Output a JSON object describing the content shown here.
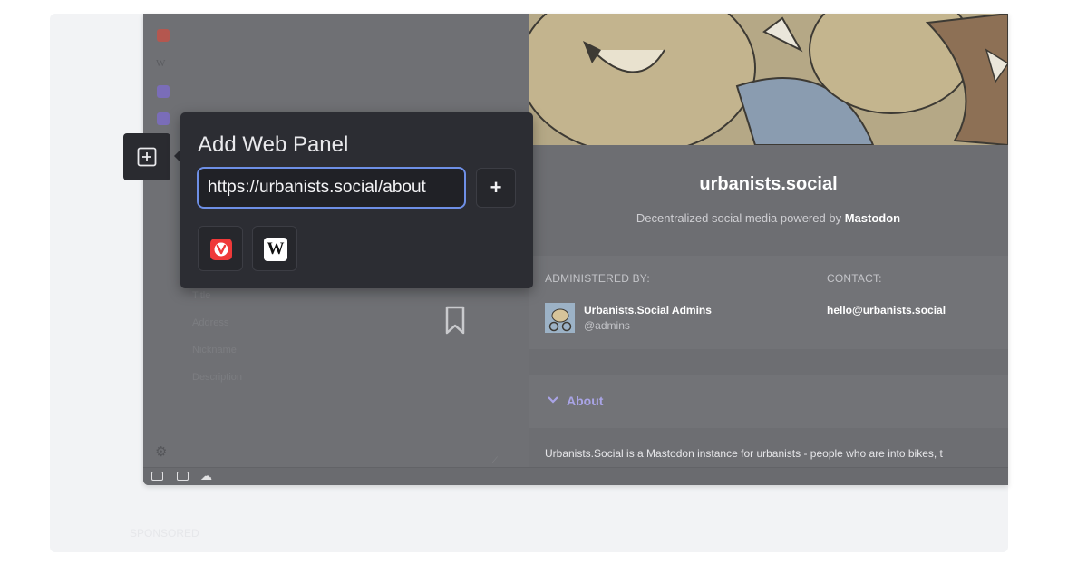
{
  "background": {
    "watermark": "SPONSORED"
  },
  "panel_form": {
    "labels": [
      "Title",
      "Address",
      "Nickname",
      "Description"
    ]
  },
  "popup": {
    "title": "Add Web Panel",
    "url_value": "https://urbanists.social/about",
    "add_button_label": "+",
    "preset_wikipedia_label": "W"
  },
  "website": {
    "title": "urbanists.social",
    "subtitle_prefix": "Decentralized social media powered by",
    "subtitle_brand": "Mastodon",
    "administered_by_heading": "ADMINISTERED BY:",
    "admin_name": "Urbanists.Social Admins",
    "admin_handle": "@admins",
    "contact_heading": "CONTACT:",
    "contact_email": "hello@urbanists.social",
    "about_label": "About",
    "about_text": "Urbanists.Social is a Mastodon instance for urbanists - people who are into bikes, t"
  },
  "colors": {
    "accent_input_border": "#6e8fe6",
    "vivaldi_red": "#ef3939",
    "mastodon_purple": "#a9a4e6",
    "popup_bg": "#2c2d33"
  },
  "icons": [
    "add-panel-icon",
    "vivaldi-icon",
    "wikipedia-icon",
    "mastodon-icon",
    "gear-icon",
    "bookmark-icon",
    "chevron-down-icon",
    "cloud-icon",
    "panel-toggle-icon",
    "tiling-icon"
  ]
}
